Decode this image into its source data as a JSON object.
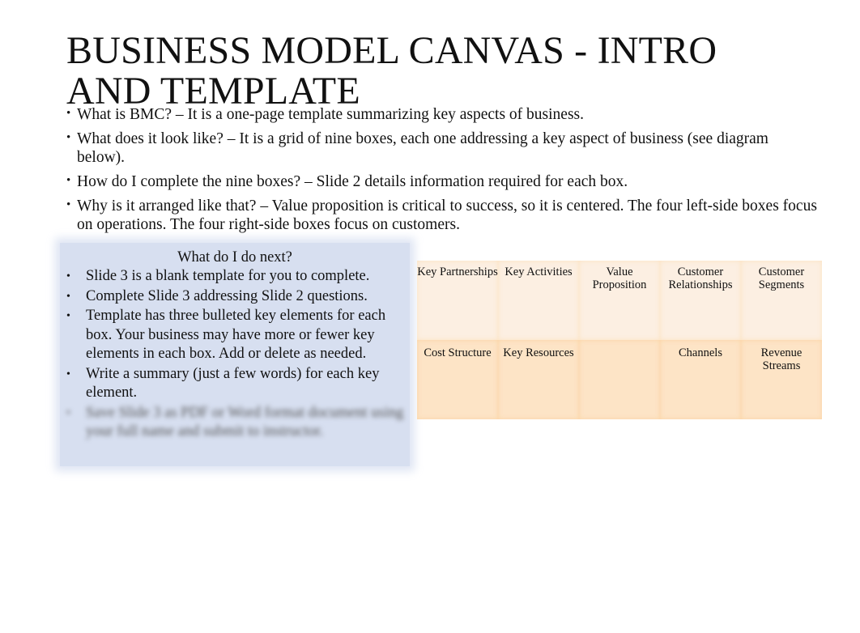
{
  "title": "BUSINESS MODEL CANVAS - INTRO AND TEMPLATE",
  "bullets": [
    "What is BMC? – It is a one-page template summarizing key aspects of business.",
    "What does it look like? – It is a grid of nine boxes, each one addressing a key aspect of business (see diagram below).",
    "How do I complete the nine boxes? – Slide 2 details information required for each box.",
    "Why is it arranged like that? – Value proposition is critical to success, so it is centered. The four left-side boxes focus on operations. The four right-side boxes focus on customers."
  ],
  "bullet_glyph": "•",
  "next_box": {
    "heading": "What do I do next?",
    "items": [
      "Slide 3 is a blank template for you to complete.",
      "Complete Slide 3 addressing Slide 2 questions.",
      "Template has three bulleted key elements for each box. Your business may have more or fewer key elements in each box. Add or delete as needed.",
      "Write a summary (just a few words) for each key element.",
      "Save Slide 3 as PDF or Word format document using your full name and submit to instructor."
    ]
  },
  "canvas": {
    "row1": [
      "Key Partnerships",
      "Key Activities",
      "Value Proposition",
      "Customer Relationships",
      "Customer Segments"
    ],
    "row2": [
      "Cost Structure",
      "Key Resources",
      "",
      "Channels",
      "Revenue Streams"
    ],
    "colors": {
      "row1": "#fcefe2",
      "row2": "#fde4c6",
      "next_box": "#d7dff0"
    }
  }
}
